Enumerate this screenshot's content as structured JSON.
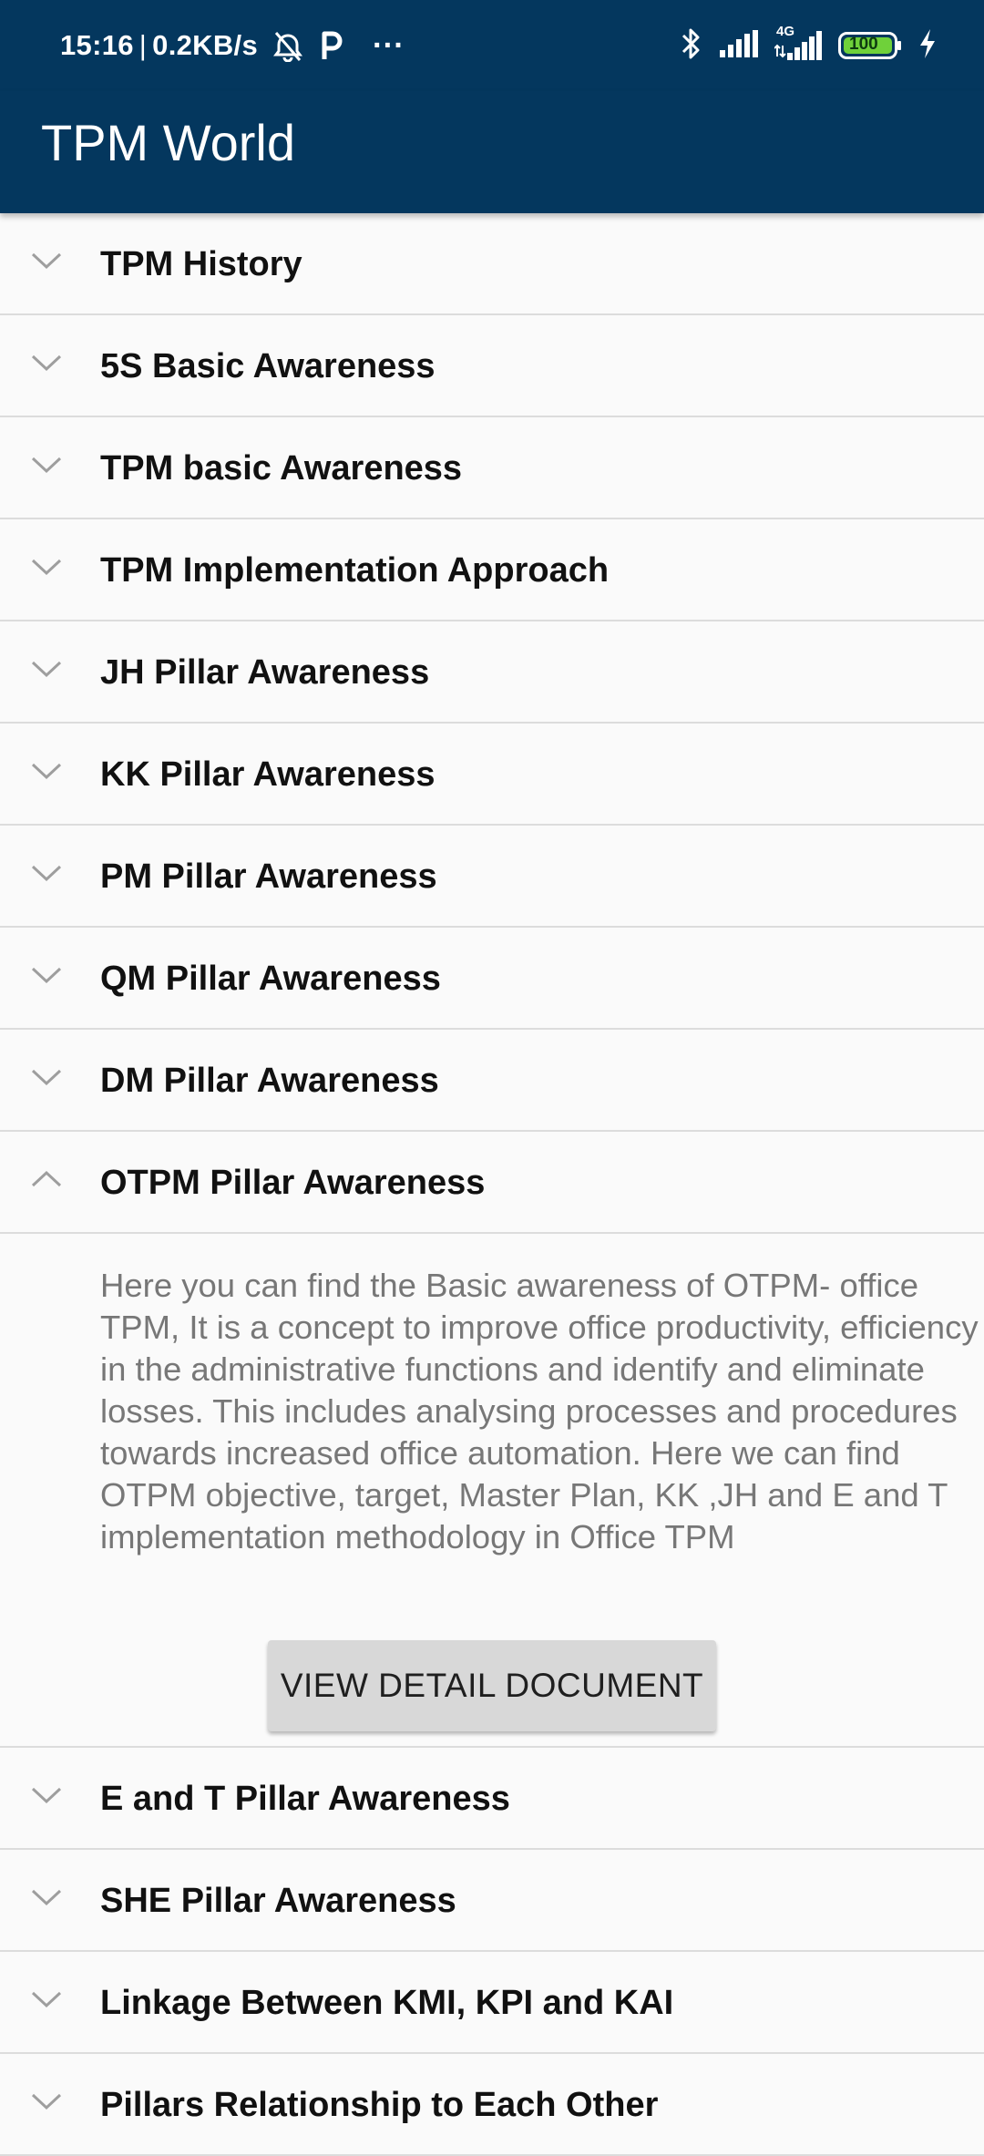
{
  "status_bar": {
    "time": "15:16",
    "speed": "0.2KB/s",
    "dots": "···",
    "network": "4G",
    "battery": "100"
  },
  "app_bar": {
    "title": "TPM World"
  },
  "items": [
    {
      "label": "TPM History"
    },
    {
      "label": "5S Basic Awareness"
    },
    {
      "label": "TPM basic Awareness"
    },
    {
      "label": "TPM Implementation Approach"
    },
    {
      "label": "JH Pillar Awareness"
    },
    {
      "label": "KK Pillar Awareness"
    },
    {
      "label": "PM Pillar Awareness"
    },
    {
      "label": "QM Pillar Awareness"
    },
    {
      "label": "DM Pillar Awareness"
    },
    {
      "label": "OTPM Pillar Awareness"
    },
    {
      "label": "E and T Pillar Awareness"
    },
    {
      "label": "SHE Pillar Awareness"
    },
    {
      "label": "Linkage Between KMI, KPI and KAI"
    },
    {
      "label": "Pillars Relationship to Each Other"
    }
  ],
  "expanded": {
    "description": "Here you can find the Basic awareness of OTPM- office TPM, It is a concept to improve office productivity, efficiency in the administrative functions and identify and eliminate losses. This includes analysing processes and procedures towards increased office automation. Here we can find OTPM objective, target, Master Plan, KK ,JH and E and T implementation methodology in Office TPM",
    "button_label": "VIEW DETAIL DOCUMENT"
  },
  "colors": {
    "app_bar": "#04375e",
    "background": "#fafafa",
    "divider": "#dcdcdc",
    "battery": "#6fd13a"
  }
}
